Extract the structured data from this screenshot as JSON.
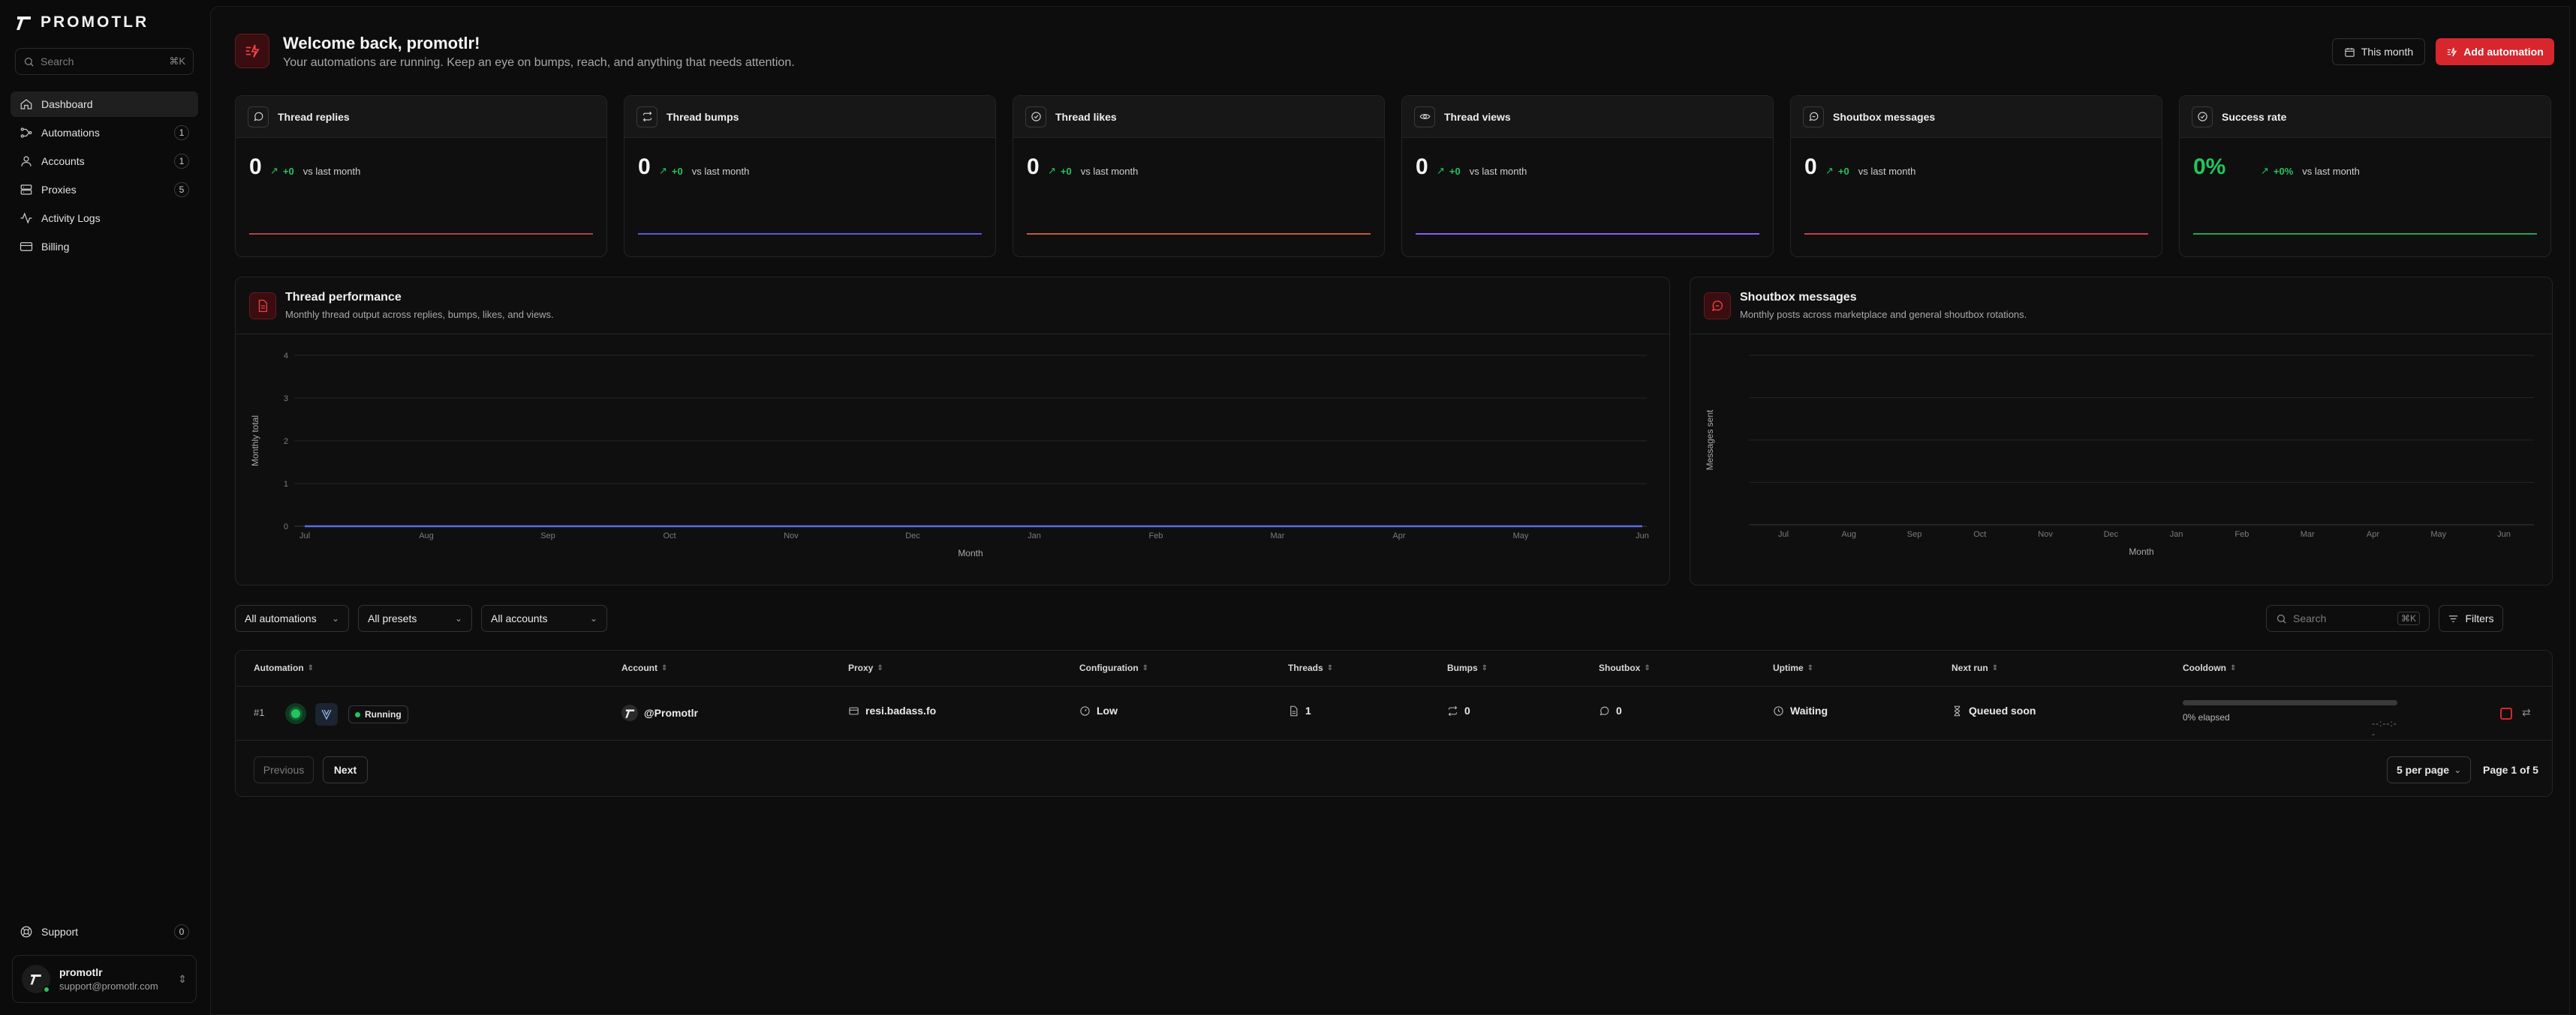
{
  "app": {
    "name": "PROMOTLR"
  },
  "sidebar": {
    "search_placeholder": "Search",
    "search_shortcut": "⌘K",
    "items": [
      {
        "label": "Dashboard",
        "icon": "home-icon",
        "badge": ""
      },
      {
        "label": "Automations",
        "icon": "workflow-icon",
        "badge": "1"
      },
      {
        "label": "Accounts",
        "icon": "user-icon",
        "badge": "1"
      },
      {
        "label": "Proxies",
        "icon": "server-icon",
        "badge": "5"
      },
      {
        "label": "Activity Logs",
        "icon": "activity-icon",
        "badge": ""
      },
      {
        "label": "Billing",
        "icon": "credit-card-icon",
        "badge": ""
      }
    ],
    "support": {
      "label": "Support",
      "badge": "0"
    },
    "user": {
      "name": "promotlr",
      "email": "support@promotlr.com"
    }
  },
  "header": {
    "title": "Welcome back, promotlr!",
    "subtitle": "Your automations are running. Keep an eye on bumps, reach, and anything that needs attention.",
    "period_button": "This month",
    "add_button": "Add automation"
  },
  "kpis": [
    {
      "label": "Thread replies",
      "value": "0",
      "delta": "+0",
      "compare": "vs last month",
      "color": "#b6404a"
    },
    {
      "label": "Thread bumps",
      "value": "0",
      "delta": "+0",
      "compare": "vs last month",
      "color": "#5b5bd6"
    },
    {
      "label": "Thread likes",
      "value": "0",
      "delta": "+0",
      "compare": "vs last month",
      "color": "#c2593a"
    },
    {
      "label": "Thread views",
      "value": "0",
      "delta": "+0",
      "compare": "vs last month",
      "color": "#8b5cf6"
    },
    {
      "label": "Shoutbox messages",
      "value": "0",
      "delta": "+0",
      "compare": "vs last month",
      "color": "#c2414b"
    },
    {
      "label": "Success rate",
      "value": "0%",
      "delta": "+0%",
      "compare": "vs last month",
      "color": "#22a35a"
    }
  ],
  "thread_chart": {
    "title": "Thread performance",
    "subtitle": "Monthly thread output across replies, bumps, likes, and views."
  },
  "shoutbox_chart": {
    "title": "Shoutbox messages",
    "subtitle": "Monthly posts across marketplace and general shoutbox rotations."
  },
  "chart_data": [
    {
      "type": "line",
      "title": "Thread performance",
      "xlabel": "Month",
      "ylabel": "Monthly total",
      "categories": [
        "Jul",
        "Aug",
        "Sep",
        "Oct",
        "Nov",
        "Dec",
        "Jan",
        "Feb",
        "Mar",
        "Apr",
        "May",
        "Jun"
      ],
      "yticks": [
        "0",
        "1",
        "2",
        "3",
        "4"
      ],
      "ylim": [
        0,
        4
      ],
      "series": [
        {
          "values": [
            0,
            0,
            0,
            0,
            0,
            0,
            0,
            0,
            0,
            0,
            0,
            0
          ],
          "color": "#5b6ee8"
        }
      ],
      "grid": true
    },
    {
      "type": "line",
      "title": "Shoutbox messages",
      "xlabel": "Month",
      "ylabel": "Messages sent",
      "categories": [
        "Jul",
        "Aug",
        "Sep",
        "Oct",
        "Nov",
        "Dec",
        "Jan",
        "Feb",
        "Mar",
        "Apr",
        "May",
        "Jun"
      ],
      "series": [],
      "grid": true
    }
  ],
  "filters": {
    "automations": "All automations",
    "presets": "All presets",
    "accounts": "All accounts",
    "search_placeholder": "Search",
    "search_shortcut": "⌘K",
    "filters_button": "Filters"
  },
  "table": {
    "columns": [
      "Automation",
      "Account",
      "Proxy",
      "Configuration",
      "Threads",
      "Bumps",
      "Shoutbox",
      "Uptime",
      "Next run",
      "Cooldown"
    ],
    "rows": [
      {
        "num": "#1",
        "status": "Running",
        "account": "@Promotlr",
        "proxy": "resi.badass.fo",
        "configuration": "Low",
        "threads": "1",
        "bumps": "0",
        "shoutbox": "0",
        "uptime": "Waiting",
        "next_run": "Queued soon",
        "cooldown_text": "0% elapsed",
        "cooldown_progress": 0
      }
    ],
    "prev": "Previous",
    "next": "Next",
    "per_page": "5 per page",
    "page_info": "Page 1 of 5"
  }
}
